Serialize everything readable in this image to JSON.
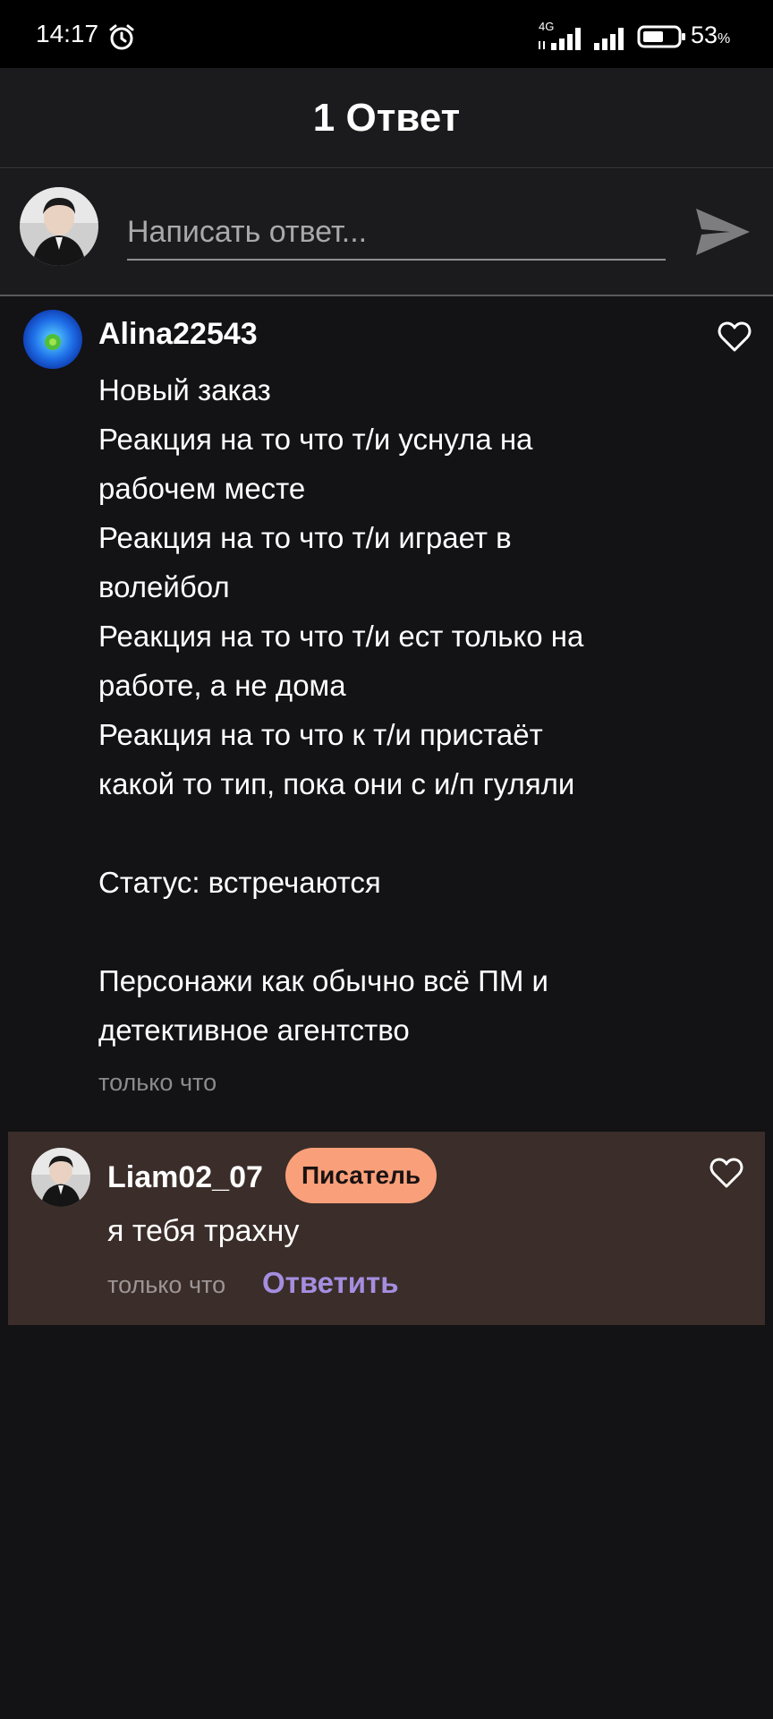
{
  "status_bar": {
    "time": "14:17",
    "network": "4G",
    "battery": "53",
    "battery_unit": "%"
  },
  "header": {
    "title": "1 Ответ"
  },
  "reply_bar": {
    "placeholder": "Написать ответ..."
  },
  "comment": {
    "author": "Alina22543",
    "body": "Новый заказ\nРеакция на то что т/и уснула на\nрабочем месте\nРеакция на то что т/и играет в\nволейбол\nРеакция на то что т/и ест только на\nработе, а не дома\nРеакция на то что к т/и пристаёт\nкакой то тип, пока они с и/п гуляли\n\nСтатус: встречаются\n\nПерсонажи как обычно всё ПМ и\nдетективное агентство",
    "time": "только что"
  },
  "reply": {
    "author": "Liam02_07",
    "badge": "Писатель",
    "body": "я тебя трахну",
    "time": "только что",
    "answer_label": "Ответить"
  },
  "colors": {
    "background": "#131214",
    "header": "#1b1a1c",
    "reply_card": "#3b2d29",
    "badge": "#f9a07a",
    "answer_link": "#a58ee0"
  },
  "icons": [
    "alarm-icon",
    "signal-icon",
    "battery-icon",
    "send-icon",
    "heart-icon"
  ]
}
